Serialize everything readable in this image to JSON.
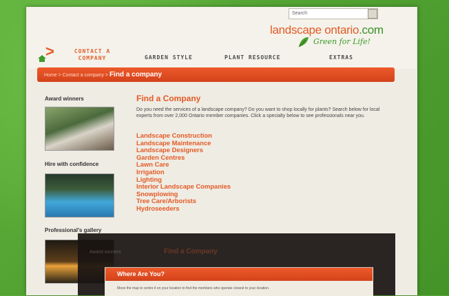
{
  "header": {
    "search_placeholder": "Search",
    "logo_main": "landscape ontario",
    "logo_dotcom": ".com",
    "tagline": "Green for Life!"
  },
  "nav": {
    "contact_line1": "CONTACT A",
    "contact_line2": "COMPANY",
    "garden_style": "GARDEN STYLE",
    "plant_resource": "PLANT RESOURCE",
    "extras": "EXTRAS"
  },
  "breadcrumb": {
    "path": "Home > Contact a company > ",
    "current": "Find a company"
  },
  "sidebar": {
    "award": "Award winners",
    "hire": "Hire with confidence",
    "gallery": "Professional's gallery"
  },
  "main": {
    "title": "Find a Company",
    "intro": "Do you need the services of a landscape company? Do you want to shop locally for plants? Search below for local experts from over 2,000 Ontario member companies. Click a specialty below to see professionals near you.",
    "services": [
      "Landscape Construction",
      "Landscape Maintenance",
      "Landscape Designers",
      "Garden Centres",
      "Lawn Care",
      "Irrigation",
      "Lighting",
      "Interior Landscape Companies",
      "Snowplowing",
      "Tree Care/Arborists",
      "Hydroseeders"
    ]
  },
  "overlay": {
    "ghost_title": "Find a Company",
    "ghost_side": "Award winners",
    "modal_title": "Where Are You?",
    "modal_text": "Move the map to centre it on your location to find the members who operate closest to your location."
  },
  "colors": {
    "accent": "#e45a25",
    "green": "#5aa83a"
  }
}
